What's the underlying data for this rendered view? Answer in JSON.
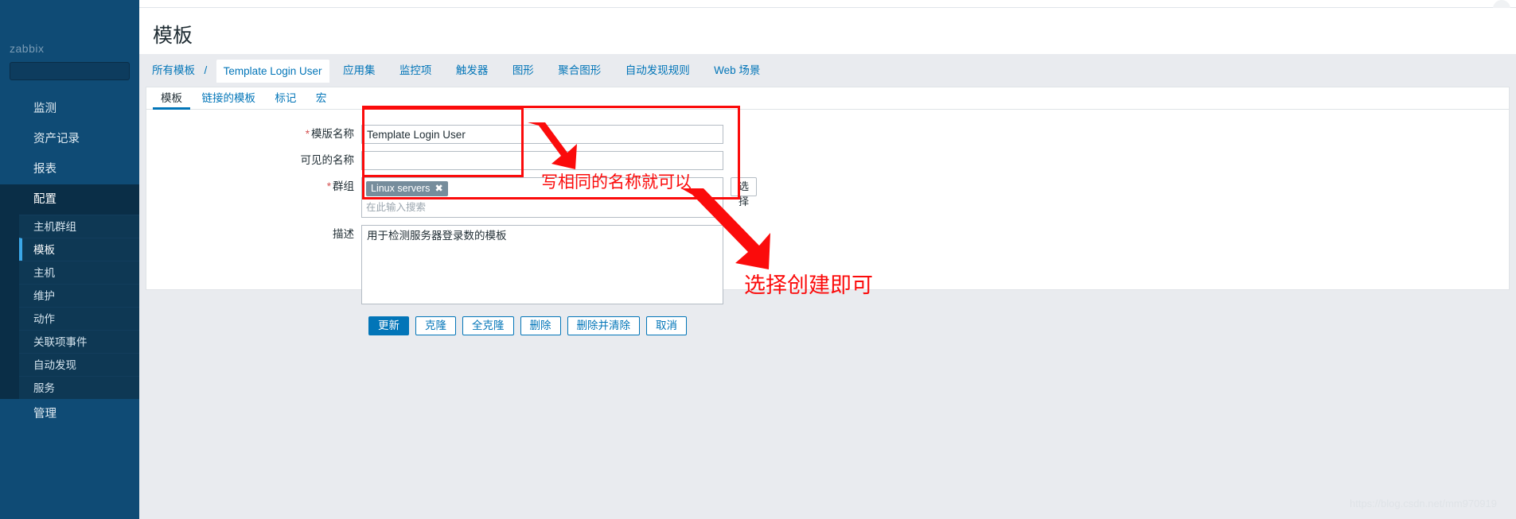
{
  "sidebar": {
    "logo": "zabbix",
    "search_placeholder": "",
    "items": [
      {
        "label": "监测"
      },
      {
        "label": "资产记录"
      },
      {
        "label": "报表"
      },
      {
        "label": "配置"
      }
    ],
    "sub_items": [
      {
        "label": "主机群组"
      },
      {
        "label": "模板"
      },
      {
        "label": "主机"
      },
      {
        "label": "维护"
      },
      {
        "label": "动作"
      },
      {
        "label": "关联项事件"
      },
      {
        "label": "自动发现"
      },
      {
        "label": "服务"
      }
    ],
    "last_item": {
      "label": "管理"
    }
  },
  "header": {
    "title": "模板"
  },
  "breadcrumb": {
    "all_templates": "所有模板",
    "separator": "/",
    "current": "Template Login User",
    "tabs": [
      {
        "label": "应用集"
      },
      {
        "label": "监控项"
      },
      {
        "label": "触发器"
      },
      {
        "label": "图形"
      },
      {
        "label": "聚合图形"
      },
      {
        "label": "自动发现规则"
      },
      {
        "label": "Web 场景"
      }
    ]
  },
  "subtabs": [
    {
      "label": "模板",
      "active": true
    },
    {
      "label": "链接的模板",
      "active": false
    },
    {
      "label": "标记",
      "active": false
    },
    {
      "label": "宏",
      "active": false
    }
  ],
  "form": {
    "template_name": {
      "label": "模版名称",
      "required": true,
      "value": "Template Login User",
      "placeholder": ""
    },
    "visible_name": {
      "label": "可见的名称",
      "required": false,
      "value": "",
      "placeholder": ""
    },
    "groups": {
      "label": "群组",
      "required": true,
      "chips": [
        {
          "label": "Linux servers",
          "remove": "✖"
        }
      ],
      "placeholder": "在此输入搜索",
      "select_button": "选择"
    },
    "description": {
      "label": "描述",
      "required": false,
      "value": "用于检测服务器登录数的模板",
      "placeholder": ""
    },
    "buttons": [
      {
        "label": "更新",
        "primary": true
      },
      {
        "label": "克隆",
        "primary": false
      },
      {
        "label": "全克隆",
        "primary": false
      },
      {
        "label": "删除",
        "primary": false
      },
      {
        "label": "删除并清除",
        "primary": false
      },
      {
        "label": "取消",
        "primary": false
      }
    ]
  },
  "annotations": {
    "color": "#fb0b0b",
    "note_same_name": "写相同的名称就可以",
    "note_create": "选择创建即可"
  },
  "watermark": "https://blog.csdn.net/mm970919"
}
